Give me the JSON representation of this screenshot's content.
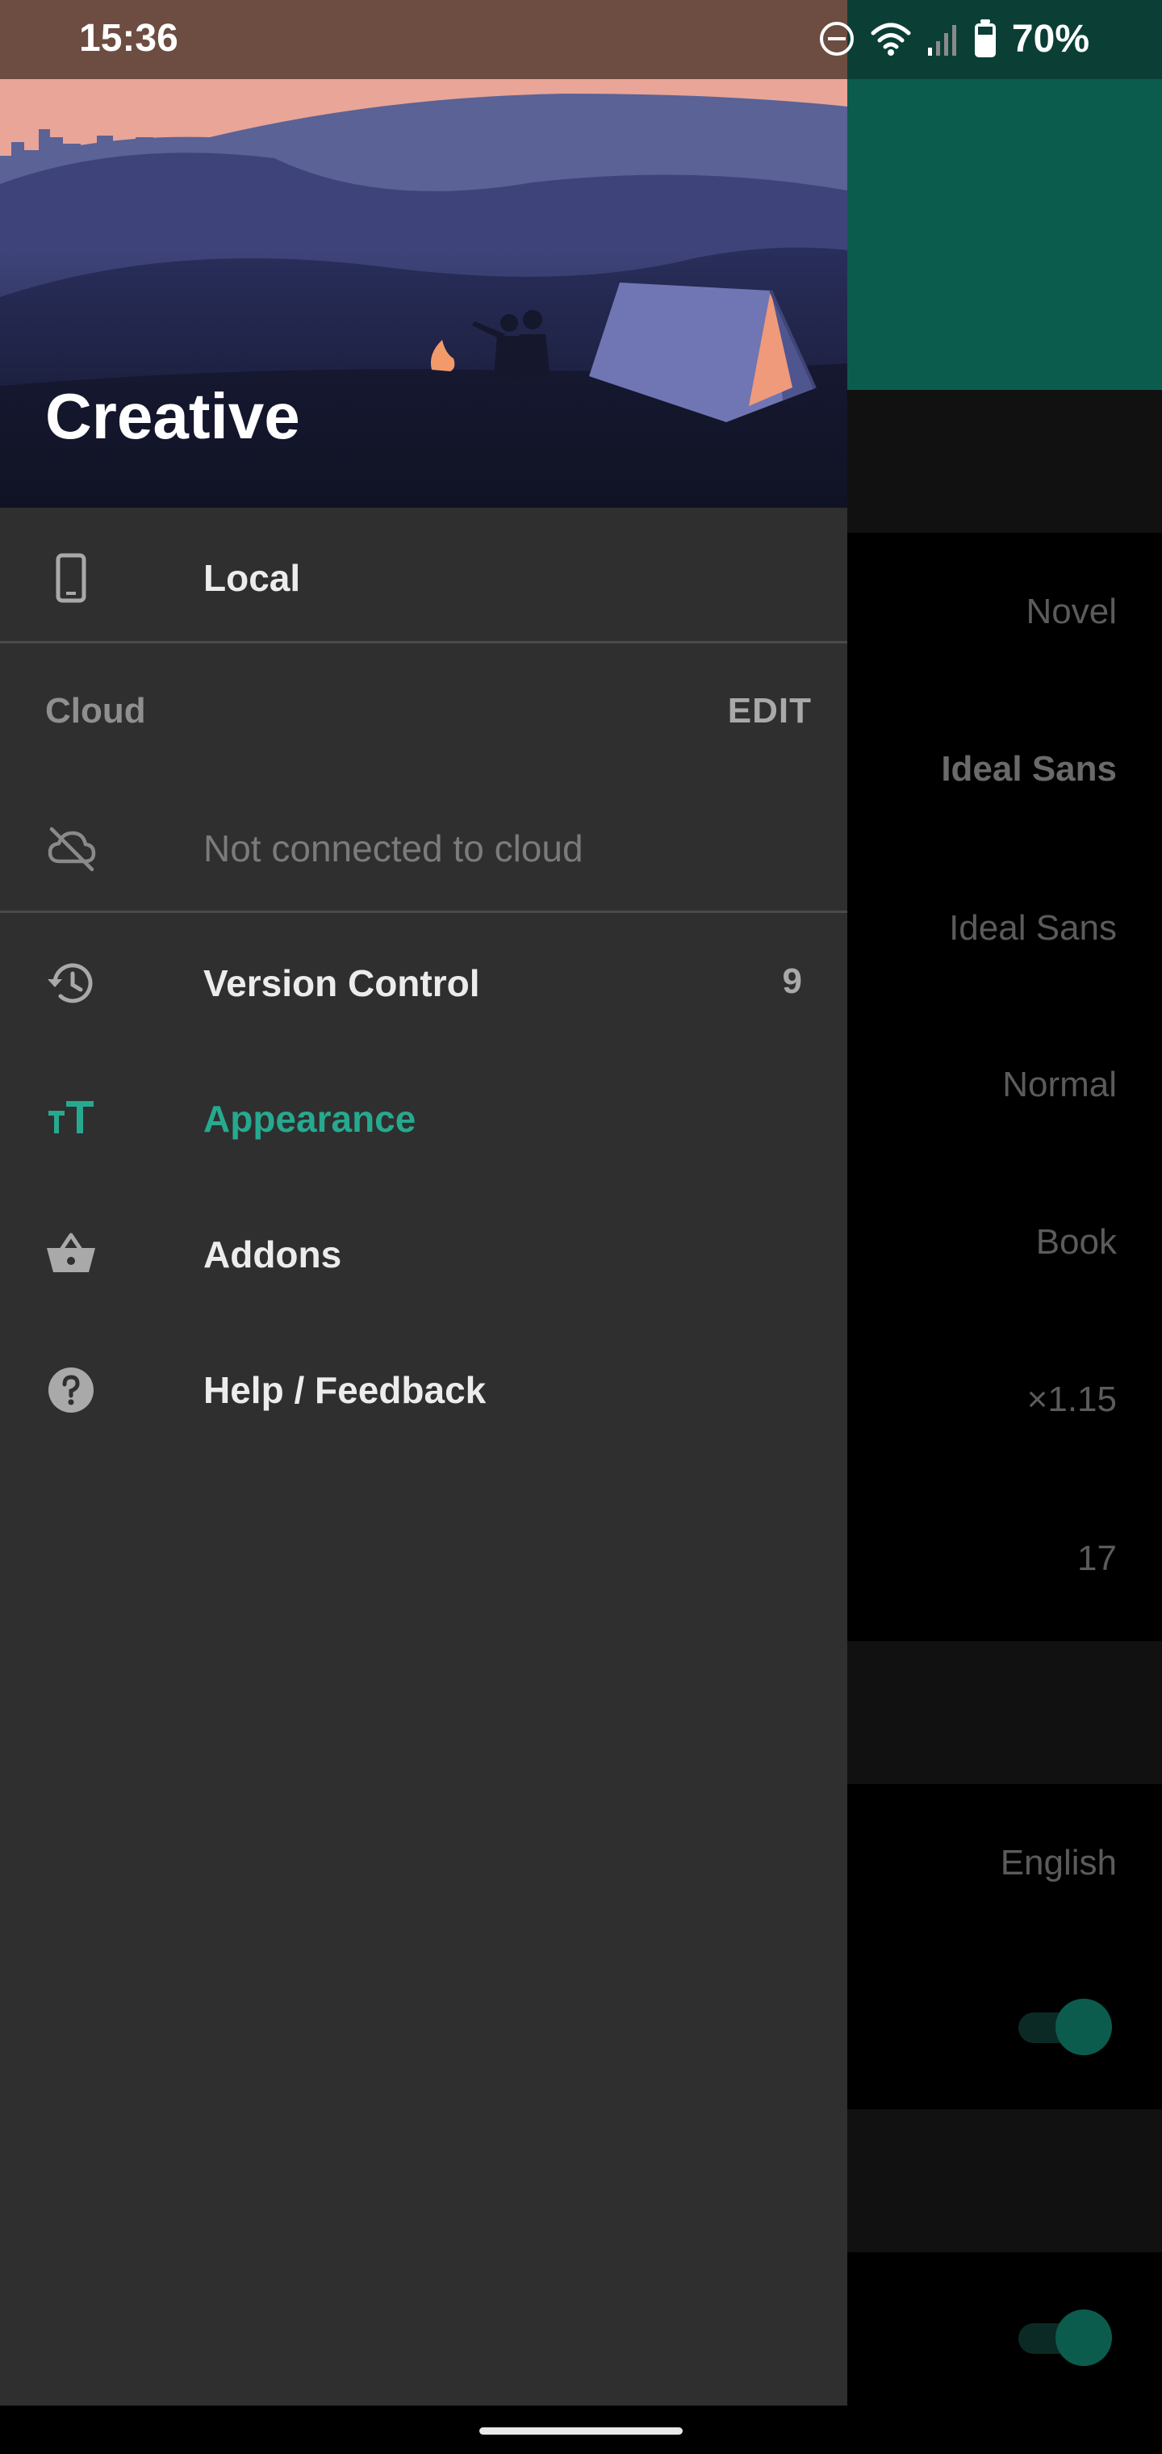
{
  "status_bar": {
    "time": "15:36",
    "battery_percent": "70%",
    "icons": [
      "do-not-disturb-icon",
      "wifi-icon",
      "signal-icon",
      "battery-icon"
    ]
  },
  "drawer": {
    "title": "Creative",
    "local": {
      "label": "Local",
      "icon": "phone-icon"
    },
    "cloud_section": {
      "label": "Cloud",
      "edit_label": "EDIT"
    },
    "cloud_status": {
      "label": "Not connected to cloud",
      "icon": "cloud-off-icon"
    },
    "items": [
      {
        "label": "Version Control",
        "badge": "9",
        "icon": "history-icon"
      },
      {
        "label": "Appearance",
        "icon": "text-size-icon",
        "active": true
      },
      {
        "label": "Addons",
        "icon": "basket-icon"
      },
      {
        "label": "Help / Feedback",
        "icon": "help-icon"
      }
    ]
  },
  "background_settings": {
    "values": [
      "Novel",
      "Ideal Sans",
      "Ideal Sans",
      "Normal",
      "Book",
      "×1.15",
      "17",
      "English"
    ],
    "toggles": [
      true,
      true
    ]
  },
  "colors": {
    "accent": "#26a98f",
    "drawer_bg": "#2f2f2f",
    "status_bar": "#6d4c41",
    "toolbar": "#0b5c4d"
  }
}
